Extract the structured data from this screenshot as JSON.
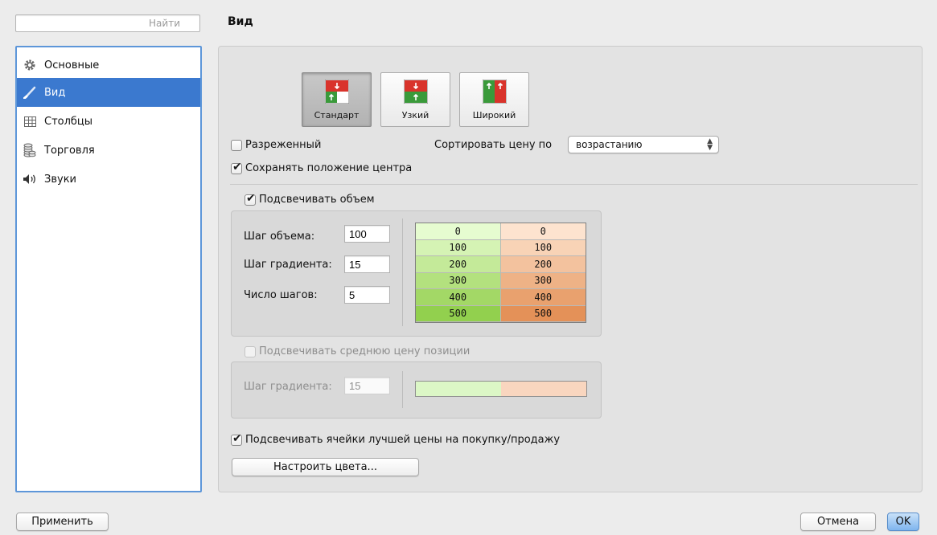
{
  "search": {
    "placeholder": "Найти"
  },
  "page_title": "Вид",
  "sidebar": {
    "items": [
      {
        "label": "Основные",
        "icon": "gear-icon"
      },
      {
        "label": "Вид",
        "icon": "brush-icon",
        "selected": true
      },
      {
        "label": "Столбцы",
        "icon": "table-icon"
      },
      {
        "label": "Торговля",
        "icon": "coins-icon"
      },
      {
        "label": "Звуки",
        "icon": "speaker-icon"
      }
    ]
  },
  "layout": {
    "options": [
      {
        "label": "Стандарт",
        "selected": true
      },
      {
        "label": "Узкий",
        "selected": false
      },
      {
        "label": "Широкий",
        "selected": false
      }
    ]
  },
  "options": {
    "sparse": {
      "label": "Разреженный",
      "checked": false
    },
    "sort_label": "Сортировать цену по",
    "sort_value": "возрастанию",
    "keep_center": {
      "label": "Сохранять положение центра",
      "checked": true
    }
  },
  "volume": {
    "checkbox": {
      "label": "Подсвечивать объем",
      "checked": true
    },
    "step_label": "Шаг объема:",
    "step_value": "100",
    "gradient_label": "Шаг градиента:",
    "gradient_value": "15",
    "count_label": "Число шагов:",
    "count_value": "5",
    "table": {
      "left": [
        "0",
        "100",
        "200",
        "300",
        "400",
        "500"
      ],
      "right": [
        "0",
        "100",
        "200",
        "300",
        "400",
        "500"
      ],
      "left_colors": [
        "#e6fcd0",
        "#d5f3b4",
        "#c4ea99",
        "#b3e17e",
        "#a3d866",
        "#92d04e"
      ],
      "right_colors": [
        "#fde3cf",
        "#f8d3b6",
        "#f3c29e",
        "#eeb286",
        "#e9a16e",
        "#e49158"
      ]
    }
  },
  "avg_price": {
    "checkbox": {
      "label": "Подсвечивать среднюю цену позиции",
      "checked": false,
      "disabled": true
    },
    "gradient_label": "Шаг градиента:",
    "gradient_value": "15",
    "bar_colors": [
      "#dcf7c6",
      "#f9d6bf"
    ]
  },
  "best_price": {
    "label": "Подсвечивать ячейки лучшей цены на покупку/продажу",
    "checked": true
  },
  "buttons": {
    "configure_colors": "Настроить цвета...",
    "apply": "Применить",
    "cancel": "Отмена",
    "ok": "OK"
  }
}
